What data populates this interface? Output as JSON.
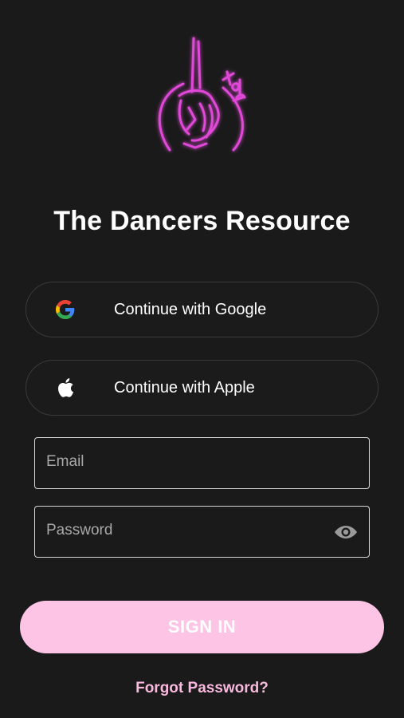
{
  "app": {
    "title": "The Dancers Resource",
    "logo_text": "tdr"
  },
  "auth": {
    "google_label": "Continue with Google",
    "apple_label": "Continue with Apple",
    "email_placeholder": "Email",
    "password_placeholder": "Password",
    "signin_label": "SIGN IN",
    "forgot_label": "Forgot Password?"
  },
  "icons": {
    "google": "google-icon",
    "apple": "apple-icon",
    "eye": "eye-icon"
  },
  "colors": {
    "background": "#1a1a1a",
    "accent_pink": "#fdc4e6",
    "link_pink": "#f9b9df",
    "neon_pink": "#e040d0"
  }
}
